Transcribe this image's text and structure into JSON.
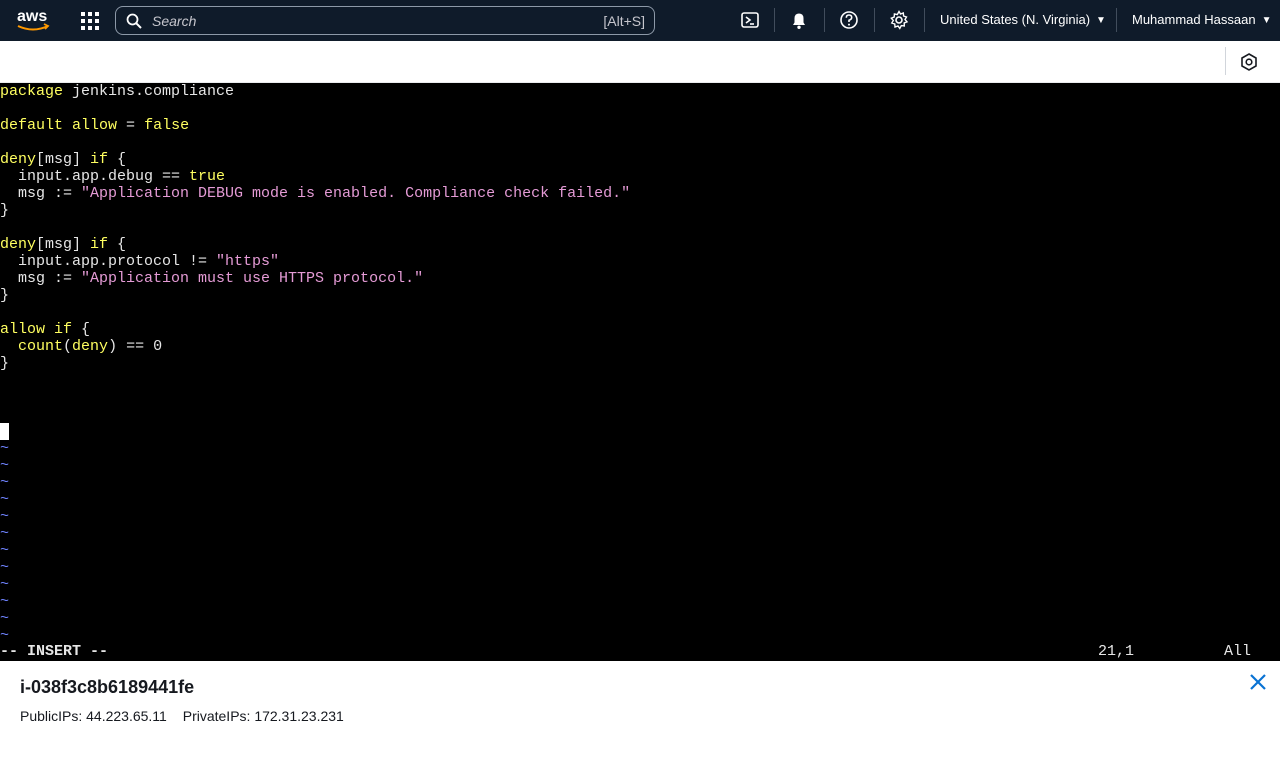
{
  "topbar": {
    "logo_text": "aws",
    "search_placeholder": "Search",
    "search_shortcut": "[Alt+S]",
    "region": "United States (N. Virginia)",
    "user": "Muhammad Hassaan",
    "icons": [
      "cloudshell-icon",
      "bell-icon",
      "help-icon",
      "settings-icon"
    ]
  },
  "editor": {
    "mode": "-- INSERT --",
    "position": "21,1",
    "scroll": "All",
    "colors": {
      "keyword": "#ffff60",
      "string": "#e59bd6",
      "tilde": "#6f83ff",
      "text": "#e6e6e6"
    },
    "lines": [
      [
        {
          "t": "package",
          "c": "kw"
        },
        {
          "t": " jenkins.compliance",
          "c": "ident"
        }
      ],
      [],
      [
        {
          "t": "default",
          "c": "kw"
        },
        {
          "t": " ",
          "c": "ident"
        },
        {
          "t": "allow",
          "c": "kw"
        },
        {
          "t": " = ",
          "c": "ident"
        },
        {
          "t": "false",
          "c": "kw"
        }
      ],
      [],
      [
        {
          "t": "deny",
          "c": "kw"
        },
        {
          "t": "[msg] ",
          "c": "ident"
        },
        {
          "t": "if",
          "c": "kw"
        },
        {
          "t": " {",
          "c": "ident"
        }
      ],
      [
        {
          "t": "  input.app.debug == ",
          "c": "ident"
        },
        {
          "t": "true",
          "c": "kw"
        }
      ],
      [
        {
          "t": "  msg := ",
          "c": "ident"
        },
        {
          "t": "\"Application DEBUG mode is enabled. Compliance check failed.\"",
          "c": "str"
        }
      ],
      [
        {
          "t": "}",
          "c": "ident"
        }
      ],
      [],
      [
        {
          "t": "deny",
          "c": "kw"
        },
        {
          "t": "[msg] ",
          "c": "ident"
        },
        {
          "t": "if",
          "c": "kw"
        },
        {
          "t": " {",
          "c": "ident"
        }
      ],
      [
        {
          "t": "  input.app.protocol != ",
          "c": "ident"
        },
        {
          "t": "\"https\"",
          "c": "str"
        }
      ],
      [
        {
          "t": "  msg := ",
          "c": "ident"
        },
        {
          "t": "\"Application must use HTTPS protocol.\"",
          "c": "str"
        }
      ],
      [
        {
          "t": "}",
          "c": "ident"
        }
      ],
      [],
      [
        {
          "t": "allow",
          "c": "kw"
        },
        {
          "t": " ",
          "c": "ident"
        },
        {
          "t": "if",
          "c": "kw"
        },
        {
          "t": " {",
          "c": "ident"
        }
      ],
      [
        {
          "t": "  ",
          "c": "ident"
        },
        {
          "t": "count",
          "c": "kw"
        },
        {
          "t": "(",
          "c": "ident"
        },
        {
          "t": "deny",
          "c": "kw"
        },
        {
          "t": ") == 0",
          "c": "ident"
        }
      ],
      [
        {
          "t": "}",
          "c": "ident"
        }
      ],
      [],
      [],
      [],
      []
    ],
    "tilde_lines": [
      "~",
      "~",
      "~",
      "~",
      "~",
      "~",
      "~",
      "~",
      "~",
      "~",
      "~",
      "~"
    ]
  },
  "footer": {
    "instance_id": "i-038f3c8b6189441fe",
    "public_ips": "PublicIPs: 44.223.65.11",
    "private_ips": "PrivateIPs: 172.31.23.231"
  }
}
